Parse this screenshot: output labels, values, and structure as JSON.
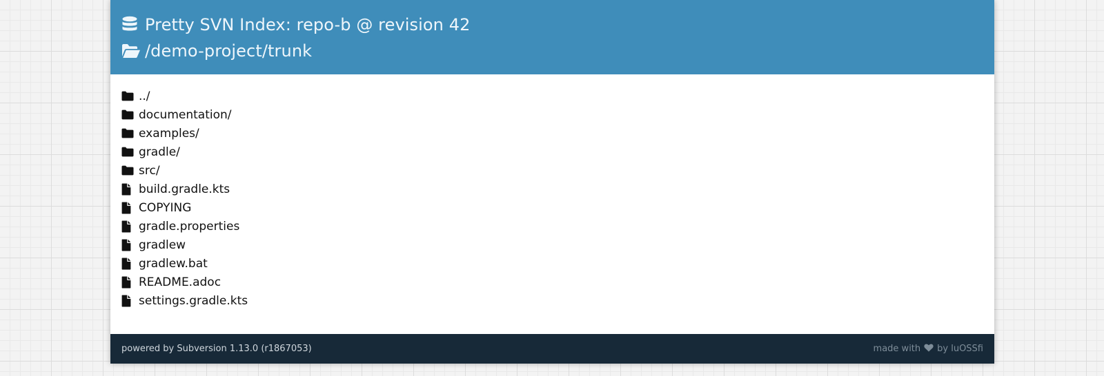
{
  "header": {
    "title": "Pretty SVN Index: repo-b @ revision 42",
    "path": "/demo-project/trunk",
    "title_icon": "database-icon",
    "path_icon": "folder-open-icon"
  },
  "entries": [
    {
      "name": "../",
      "type": "folder"
    },
    {
      "name": "documentation/",
      "type": "folder"
    },
    {
      "name": "examples/",
      "type": "folder"
    },
    {
      "name": "gradle/",
      "type": "folder"
    },
    {
      "name": "src/",
      "type": "folder"
    },
    {
      "name": "build.gradle.kts",
      "type": "file"
    },
    {
      "name": "COPYING",
      "type": "file"
    },
    {
      "name": "gradle.properties",
      "type": "file"
    },
    {
      "name": "gradlew",
      "type": "file"
    },
    {
      "name": "gradlew.bat",
      "type": "file"
    },
    {
      "name": "README.adoc",
      "type": "file"
    },
    {
      "name": "settings.gradle.kts",
      "type": "file"
    }
  ],
  "footer": {
    "powered_by": "powered by Subversion 1.13.0 (r1867053)",
    "made_with": "made with",
    "by": "by luOSSfi",
    "heart_icon": "heart-icon"
  },
  "colors": {
    "header_bg": "#3f8dba",
    "footer_bg": "#172938",
    "page_bg": "#f3f3f3",
    "text": "#111111"
  }
}
